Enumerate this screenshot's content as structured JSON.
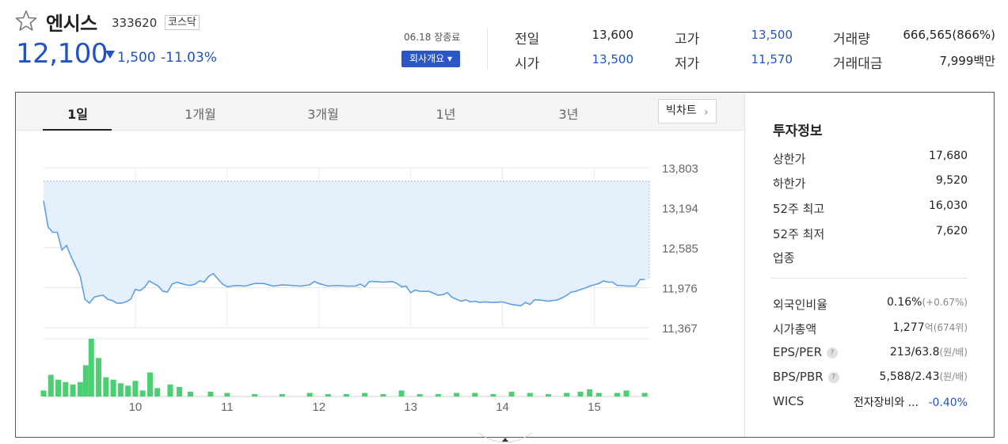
{
  "stock": {
    "name": "엔시스",
    "code": "333620",
    "market": "코스닥",
    "price": "12,100",
    "change_amount": "1,500",
    "change_percent": "-11.03%"
  },
  "session": {
    "date": "06.18",
    "status": "장종료",
    "company_button": "회사개요 ▾"
  },
  "quote": {
    "prev_close_label": "전일",
    "prev_close": "13,600",
    "high_label": "고가",
    "high": "13,500",
    "volume_label": "거래량",
    "volume": "666,565(866%)",
    "open_label": "시가",
    "open": "13,500",
    "low_label": "저가",
    "low": "11,570",
    "value_label": "거래대금",
    "value": "7,999백만"
  },
  "tabs": [
    {
      "label": "1일"
    },
    {
      "label": "1개월"
    },
    {
      "label": "3개월"
    },
    {
      "label": "1년"
    },
    {
      "label": "3년"
    }
  ],
  "candle_button": "빅차트",
  "info": {
    "title": "투자정보",
    "upper_limit_label": "상한가",
    "upper_limit": "17,680",
    "lower_limit_label": "하한가",
    "lower_limit": "9,520",
    "wk52_high_label": "52주 최고",
    "wk52_high": "16,030",
    "wk52_low_label": "52주 최저",
    "wk52_low": "7,620",
    "industry_label": "업종",
    "foreign_label": "외국인비율",
    "foreign_main": "0.16%",
    "foreign_sub": "(+0.67%)",
    "mcap_label": "시가총액",
    "mcap_main": "1,277",
    "mcap_unit": "억",
    "mcap_sub": "(674위)",
    "eps_label": "EPS/PER",
    "eps_main": "213/63.8",
    "eps_sub": "(원/배)",
    "bps_label": "BPS/PBR",
    "bps_main": "5,588/2.43",
    "bps_sub": "(원/배)",
    "help_glyph": "?",
    "wics_label": "WICS",
    "wics_sector": "전자장비와 ...",
    "wics_change": "-0.40%"
  },
  "colors": {
    "accent_blue": "#1f53c5",
    "rise_red": "#e52f2f",
    "line": "#5ca0e6",
    "area_fill": "#e6f0fd",
    "volume_bar": "#4ccf72"
  },
  "chart_data": {
    "type": "area",
    "reference_line": 13600,
    "ylim": [
      11367,
      13803
    ],
    "y_ticks": [
      "13,803",
      "13,194",
      "12,585",
      "11,976",
      "11,367"
    ],
    "y_tick_values": [
      13803,
      13194,
      12585,
      11976,
      11367
    ],
    "x_ticks": [
      "10",
      "11",
      "12",
      "13",
      "14",
      "15"
    ],
    "x_tick_positions": [
      10,
      11,
      12,
      13,
      14,
      15
    ],
    "xlim": [
      9.0,
      15.6
    ],
    "price_series": [
      [
        9.0,
        13300
      ],
      [
        9.05,
        12900
      ],
      [
        9.1,
        12820
      ],
      [
        9.15,
        12820
      ],
      [
        9.2,
        12550
      ],
      [
        9.25,
        12620
      ],
      [
        9.3,
        12450
      ],
      [
        9.35,
        12300
      ],
      [
        9.4,
        12150
      ],
      [
        9.45,
        11800
      ],
      [
        9.5,
        11740
      ],
      [
        9.55,
        11830
      ],
      [
        9.6,
        11850
      ],
      [
        9.65,
        11860
      ],
      [
        9.7,
        11800
      ],
      [
        9.75,
        11780
      ],
      [
        9.8,
        11740
      ],
      [
        9.85,
        11740
      ],
      [
        9.9,
        11760
      ],
      [
        9.95,
        11800
      ],
      [
        10.0,
        11950
      ],
      [
        10.05,
        11930
      ],
      [
        10.1,
        11980
      ],
      [
        10.15,
        12080
      ],
      [
        10.2,
        12040
      ],
      [
        10.25,
        12000
      ],
      [
        10.3,
        11920
      ],
      [
        10.35,
        11910
      ],
      [
        10.4,
        12030
      ],
      [
        10.45,
        12060
      ],
      [
        10.5,
        12040
      ],
      [
        10.55,
        12020
      ],
      [
        10.6,
        12010
      ],
      [
        10.65,
        12030
      ],
      [
        10.7,
        12080
      ],
      [
        10.75,
        12060
      ],
      [
        10.8,
        12150
      ],
      [
        10.85,
        12190
      ],
      [
        10.9,
        12110
      ],
      [
        10.95,
        12030
      ],
      [
        11.0,
        11990
      ],
      [
        11.1,
        12010
      ],
      [
        11.2,
        12000
      ],
      [
        11.3,
        12040
      ],
      [
        11.4,
        12040
      ],
      [
        11.5,
        12000
      ],
      [
        11.6,
        12020
      ],
      [
        11.7,
        12010
      ],
      [
        11.8,
        12000
      ],
      [
        11.9,
        12020
      ],
      [
        11.95,
        12070
      ],
      [
        12.0,
        12040
      ],
      [
        12.1,
        12000
      ],
      [
        12.2,
        12010
      ],
      [
        12.3,
        12000
      ],
      [
        12.4,
        12000
      ],
      [
        12.45,
        12030
      ],
      [
        12.5,
        11990
      ],
      [
        12.55,
        12070
      ],
      [
        12.6,
        12070
      ],
      [
        12.7,
        12060
      ],
      [
        12.8,
        12070
      ],
      [
        12.85,
        12040
      ],
      [
        12.9,
        11990
      ],
      [
        12.95,
        12000
      ],
      [
        13.0,
        11900
      ],
      [
        13.05,
        11940
      ],
      [
        13.1,
        11920
      ],
      [
        13.2,
        11920
      ],
      [
        13.25,
        11890
      ],
      [
        13.3,
        11860
      ],
      [
        13.35,
        11870
      ],
      [
        13.4,
        11900
      ],
      [
        13.45,
        11830
      ],
      [
        13.5,
        11800
      ],
      [
        13.55,
        11770
      ],
      [
        13.6,
        11790
      ],
      [
        13.65,
        11760
      ],
      [
        13.7,
        11770
      ],
      [
        13.75,
        11750
      ],
      [
        13.8,
        11760
      ],
      [
        13.9,
        11750
      ],
      [
        14.0,
        11760
      ],
      [
        14.05,
        11740
      ],
      [
        14.1,
        11720
      ],
      [
        14.15,
        11710
      ],
      [
        14.2,
        11700
      ],
      [
        14.25,
        11750
      ],
      [
        14.3,
        11720
      ],
      [
        14.35,
        11790
      ],
      [
        14.4,
        11790
      ],
      [
        14.5,
        11770
      ],
      [
        14.6,
        11790
      ],
      [
        14.65,
        11820
      ],
      [
        14.7,
        11860
      ],
      [
        14.75,
        11910
      ],
      [
        14.8,
        11920
      ],
      [
        14.85,
        11950
      ],
      [
        14.9,
        11970
      ],
      [
        14.95,
        12000
      ],
      [
        15.0,
        12020
      ],
      [
        15.05,
        12040
      ],
      [
        15.1,
        12080
      ],
      [
        15.15,
        12060
      ],
      [
        15.2,
        12060
      ],
      [
        15.25,
        12010
      ],
      [
        15.3,
        12010
      ],
      [
        15.35,
        12000
      ],
      [
        15.4,
        12000
      ],
      [
        15.45,
        12000
      ],
      [
        15.5,
        12100
      ],
      [
        15.55,
        12100
      ]
    ],
    "volume_series": [
      [
        9.0,
        5
      ],
      [
        9.08,
        18
      ],
      [
        9.16,
        14
      ],
      [
        9.24,
        12
      ],
      [
        9.32,
        10
      ],
      [
        9.4,
        12
      ],
      [
        9.46,
        26
      ],
      [
        9.52,
        48
      ],
      [
        9.6,
        32
      ],
      [
        9.68,
        16
      ],
      [
        9.76,
        14
      ],
      [
        9.84,
        11
      ],
      [
        9.92,
        9
      ],
      [
        10.0,
        13
      ],
      [
        10.08,
        5
      ],
      [
        10.16,
        20
      ],
      [
        10.24,
        7
      ],
      [
        10.38,
        10
      ],
      [
        10.48,
        8
      ],
      [
        10.6,
        4
      ],
      [
        10.82,
        4
      ],
      [
        11.0,
        3
      ],
      [
        11.3,
        2
      ],
      [
        11.6,
        2
      ],
      [
        11.9,
        3
      ],
      [
        12.1,
        2
      ],
      [
        12.3,
        2
      ],
      [
        12.5,
        3
      ],
      [
        12.7,
        2
      ],
      [
        12.9,
        5
      ],
      [
        13.1,
        2
      ],
      [
        13.3,
        2
      ],
      [
        13.5,
        3
      ],
      [
        13.7,
        3
      ],
      [
        13.9,
        2
      ],
      [
        14.1,
        4
      ],
      [
        14.3,
        3
      ],
      [
        14.5,
        2
      ],
      [
        14.7,
        3
      ],
      [
        14.85,
        4
      ],
      [
        14.95,
        6
      ],
      [
        15.05,
        3
      ],
      [
        15.25,
        3
      ],
      [
        15.35,
        5
      ],
      [
        15.55,
        3
      ]
    ]
  }
}
